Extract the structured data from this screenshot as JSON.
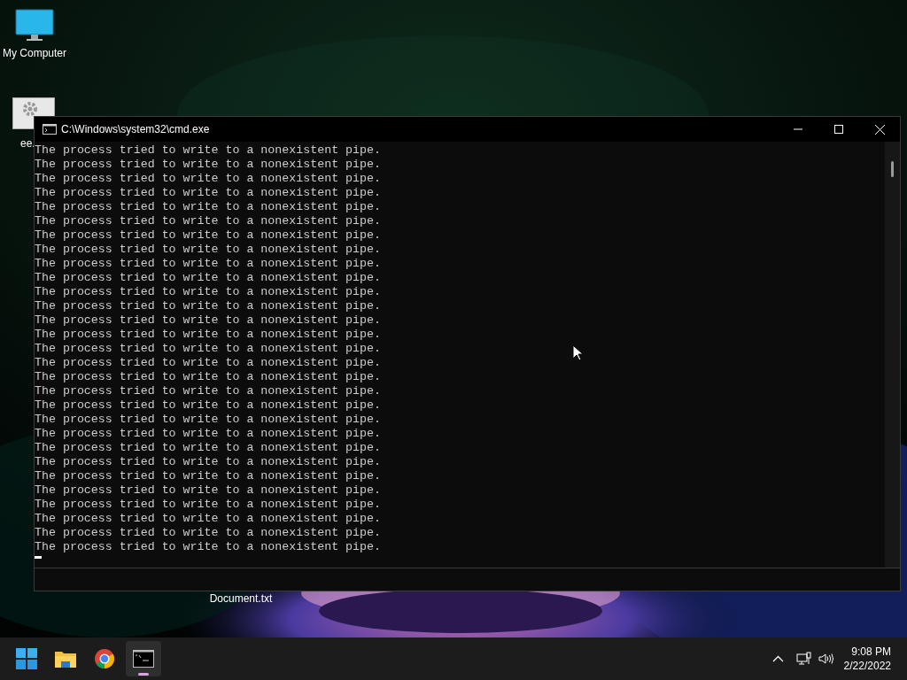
{
  "desktop_icons": [
    {
      "kind": "monitor",
      "label": "My Computer"
    },
    {
      "kind": "settings-file",
      "label": "ee."
    },
    {
      "kind": "text-file",
      "label": "Document.txt"
    }
  ],
  "window": {
    "title": "C:\\Windows\\system32\\cmd.exe",
    "lines": [
      "The process tried to write to a nonexistent pipe.",
      "The process tried to write to a nonexistent pipe.",
      "The process tried to write to a nonexistent pipe.",
      "The process tried to write to a nonexistent pipe.",
      "The process tried to write to a nonexistent pipe.",
      "The process tried to write to a nonexistent pipe.",
      "The process tried to write to a nonexistent pipe.",
      "The process tried to write to a nonexistent pipe.",
      "The process tried to write to a nonexistent pipe.",
      "The process tried to write to a nonexistent pipe.",
      "The process tried to write to a nonexistent pipe.",
      "The process tried to write to a nonexistent pipe.",
      "The process tried to write to a nonexistent pipe.",
      "The process tried to write to a nonexistent pipe.",
      "The process tried to write to a nonexistent pipe.",
      "The process tried to write to a nonexistent pipe.",
      "The process tried to write to a nonexistent pipe.",
      "The process tried to write to a nonexistent pipe.",
      "The process tried to write to a nonexistent pipe.",
      "The process tried to write to a nonexistent pipe.",
      "The process tried to write to a nonexistent pipe.",
      "The process tried to write to a nonexistent pipe.",
      "The process tried to write to a nonexistent pipe.",
      "The process tried to write to a nonexistent pipe.",
      "The process tried to write to a nonexistent pipe.",
      "The process tried to write to a nonexistent pipe.",
      "The process tried to write to a nonexistent pipe.",
      "The process tried to write to a nonexistent pipe.",
      "The process tried to write to a nonexistent pipe."
    ]
  },
  "taskbar": {
    "apps": [
      {
        "kind": "start",
        "selected": false
      },
      {
        "kind": "folder",
        "selected": false
      },
      {
        "kind": "browser",
        "selected": false
      },
      {
        "kind": "terminal",
        "selected": true
      }
    ],
    "time": "9:08 PM",
    "date": "2/22/2022"
  }
}
